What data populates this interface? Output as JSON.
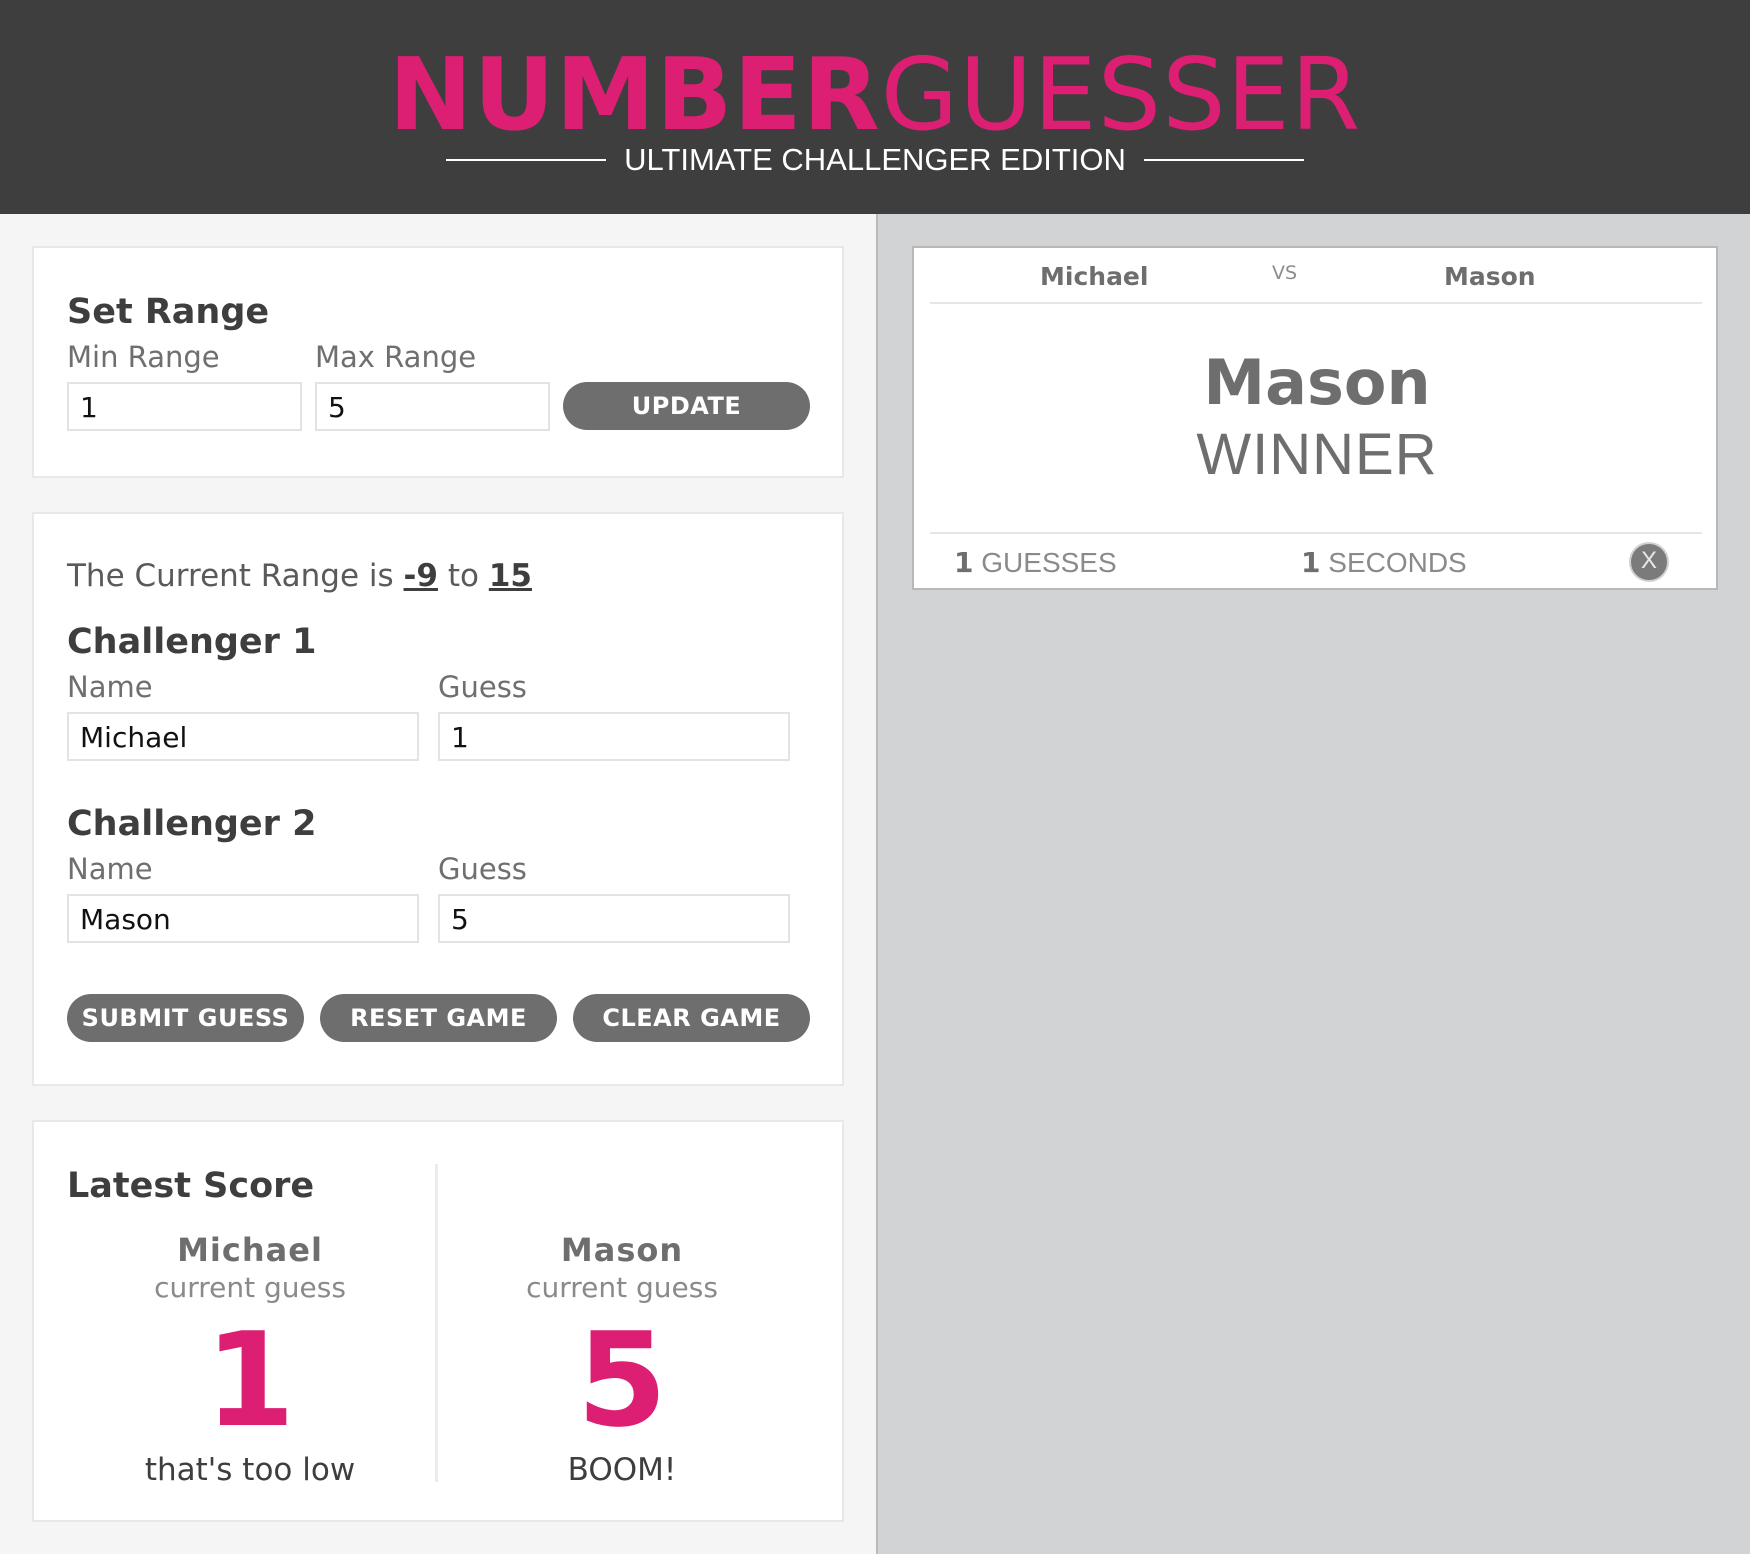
{
  "header": {
    "title_bold": "NUMBER",
    "title_light": "GUESSER",
    "subtitle": "ULTIMATE CHALLENGER EDITION"
  },
  "set_range": {
    "heading": "Set Range",
    "min_label": "Min Range",
    "max_label": "Max Range",
    "min_value": "1",
    "max_value": "5",
    "update_label": "UPDATE"
  },
  "game": {
    "range_prefix": "The Current Range is",
    "range_min": "-9",
    "range_joiner": "to",
    "range_max": "15",
    "challenger1": {
      "heading": "Challenger 1",
      "name_label": "Name",
      "guess_label": "Guess",
      "name_value": "Michael",
      "guess_value": "1"
    },
    "challenger2": {
      "heading": "Challenger 2",
      "name_label": "Name",
      "guess_label": "Guess",
      "name_value": "Mason",
      "guess_value": "5"
    },
    "submit_label": "SUBMIT GUESS",
    "reset_label": "RESET GAME",
    "clear_label": "CLEAR GAME"
  },
  "latest_score": {
    "heading": "Latest Score",
    "players": [
      {
        "name": "Michael",
        "sub": "current guess",
        "guess": "1",
        "message": "that's too low"
      },
      {
        "name": "Mason",
        "sub": "current guess",
        "guess": "5",
        "message": "BOOM!"
      }
    ]
  },
  "result_card": {
    "challenger1": "Michael",
    "vs": "VS",
    "challenger2": "Mason",
    "winner_name": "Mason",
    "winner_label": "WINNER",
    "guesses_count": "1",
    "guesses_label": "GUESSES",
    "seconds_count": "1",
    "seconds_label": "SECONDS",
    "close_label": "X"
  },
  "colors": {
    "accent": "#dd1f74",
    "header_bg": "#3e3e3e",
    "button_bg": "#6e6e6e",
    "right_bg": "#d2d3d5"
  }
}
